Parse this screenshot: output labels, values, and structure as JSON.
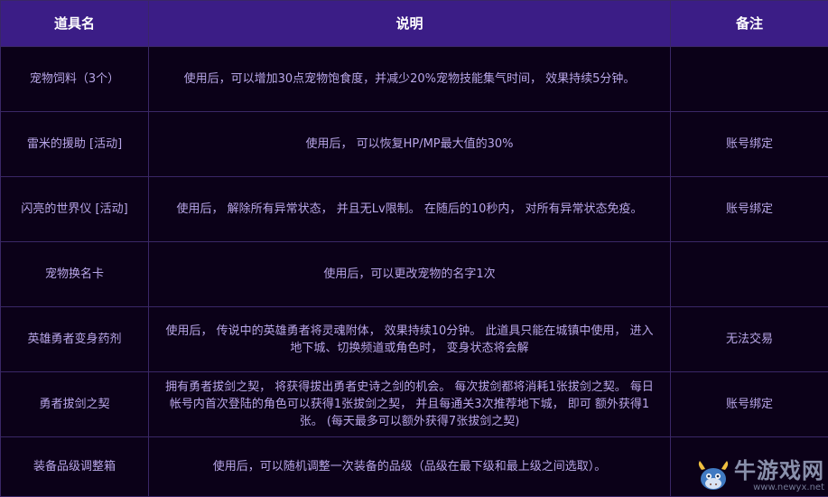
{
  "table": {
    "headers": [
      "道具名",
      "说明",
      "备注"
    ],
    "rows": [
      {
        "name": "宠物饲料（3个）",
        "desc": "使用后，可以增加30点宠物饱食度，并减少20%宠物技能集气时间， 效果持续5分钟。",
        "note": ""
      },
      {
        "name": "雷米的援助 [活动]",
        "desc": "使用后， 可以恢复HP/MP最大值的30%",
        "note": "账号绑定"
      },
      {
        "name": "闪亮的世界仪 [活动]",
        "desc": "使用后， 解除所有异常状态， 并且无Lv限制。 在随后的10秒内， 对所有异常状态免疫。",
        "note": "账号绑定"
      },
      {
        "name": "宠物换名卡",
        "desc": "使用后，可以更改宠物的名字1次",
        "note": ""
      },
      {
        "name": "英雄勇者变身药剂",
        "desc": "使用后， 传说中的英雄勇者将灵魂附体， 效果持续10分钟。 此道具只能在城镇中使用， 进入地下城、切换频道或角色时， 变身状态将会解",
        "note": "无法交易"
      },
      {
        "name": "勇者拔剑之契",
        "desc": "拥有勇者拔剑之契， 将获得拔出勇者史诗之剑的机会。 每次拔剑都将消耗1张拔剑之契。 每日帐号内首次登陆的角色可以获得1张拔剑之契， 并且每通关3次推荐地下城， 即可 额外获得1张。 (每天最多可以额外获得7张拔剑之契)",
        "note": "账号绑定"
      },
      {
        "name": "装备品级调整箱",
        "desc": "使用后，可以随机调整一次装备的品级（品级在最下级和最上级之间选取）。",
        "note": ""
      }
    ]
  },
  "watermark": {
    "text": "牛游戏网",
    "url": "www.newyx.net",
    "logo_icon": "cow-mascot-logo"
  },
  "colors": {
    "header_bg": "#3b1d86",
    "body_bg": "#0b0118",
    "text": "#b8a6e8",
    "border": "#3a2766"
  }
}
